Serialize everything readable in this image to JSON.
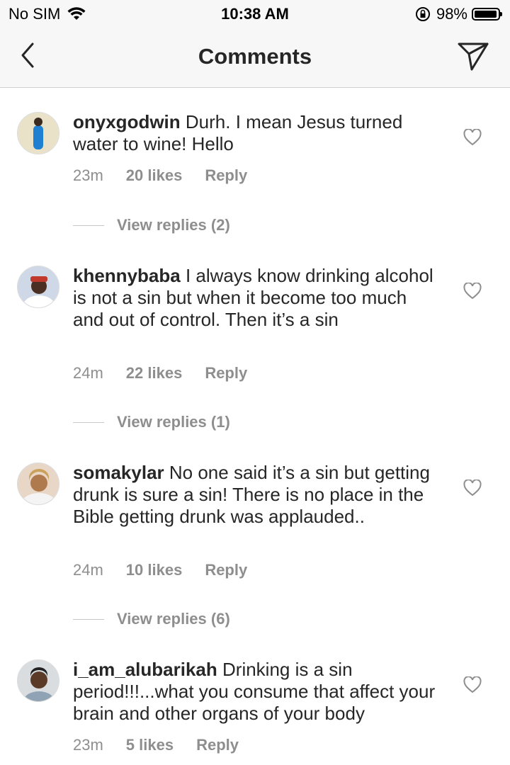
{
  "status_bar": {
    "carrier": "No SIM",
    "time": "10:38 AM",
    "battery_percent": "98%",
    "battery_level": 0.98
  },
  "nav": {
    "title": "Comments",
    "back_icon": "chevron-left-icon",
    "send_icon": "paper-plane-icon"
  },
  "comments": [
    {
      "username": "onyxgodwin",
      "text": "Durh. I mean Jesus turned water to wine! Hello",
      "time": "23m",
      "likes": "20 likes",
      "reply": "Reply",
      "view_replies": "View replies (2)"
    },
    {
      "username": "khennybaba",
      "text": "I always know drinking alcohol is not a sin but when it become too much and out of control. Then it’s a sin",
      "time": "24m",
      "likes": "22 likes",
      "reply": "Reply",
      "view_replies": "View replies (1)"
    },
    {
      "username": "somakylar",
      "text": "No one said it’s a sin but getting drunk is sure a sin! There is no place in the Bible getting drunk was applauded..",
      "time": "24m",
      "likes": "10 likes",
      "reply": "Reply",
      "view_replies": "View replies (6)"
    },
    {
      "username": "i_am_alubarikah",
      "text": "Drinking is a sin period!!!...what you consume that affect your brain and other organs of your body",
      "time": "23m",
      "likes": "5 likes",
      "reply": "Reply"
    }
  ],
  "colors": {
    "text": "#262626",
    "secondary": "#8e8e8e",
    "bar_bg": "#f7f7f7"
  }
}
